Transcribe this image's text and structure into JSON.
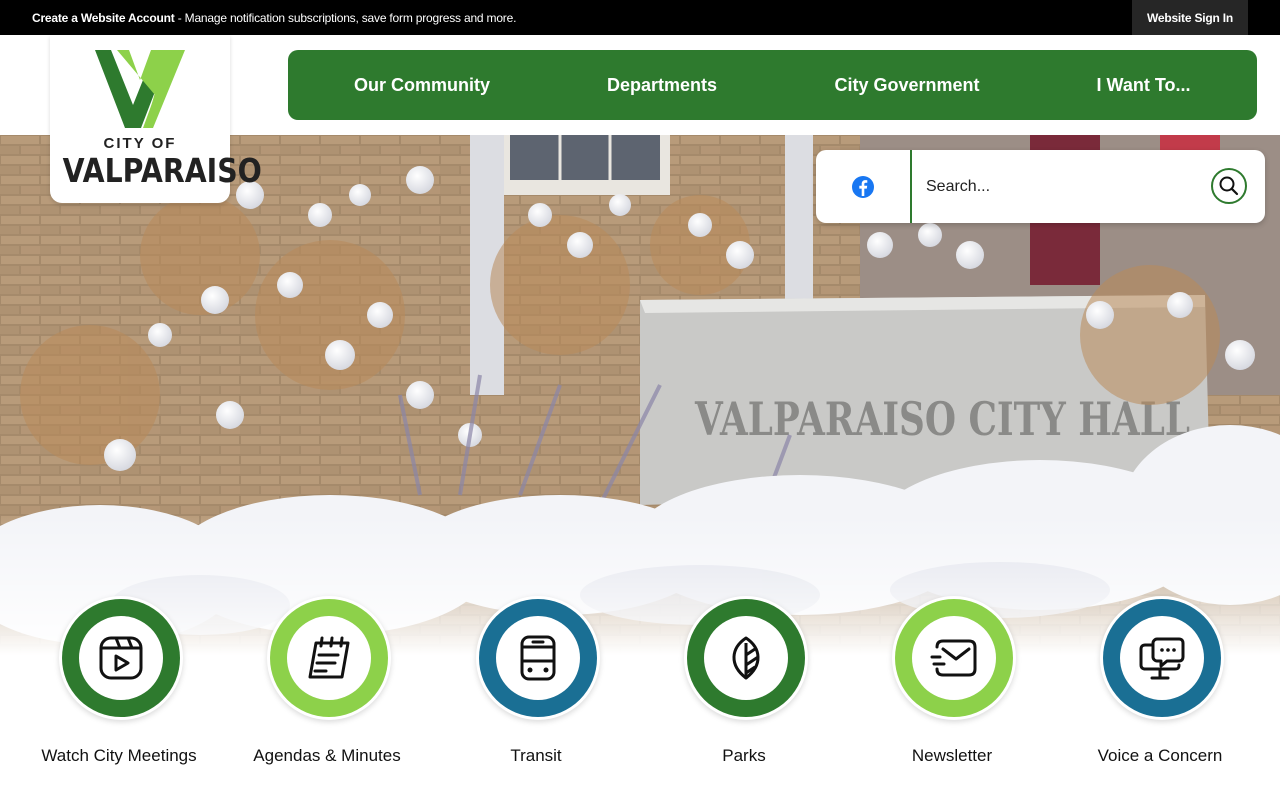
{
  "topbar": {
    "account_link": "Create a Website Account",
    "account_desc": " - Manage notification subscriptions, save form progress and more.",
    "signin_label": "Website Sign In"
  },
  "logo": {
    "city_of": "CITY OF",
    "name": "VALPARAISO"
  },
  "nav": {
    "items": [
      {
        "label": "Our Community"
      },
      {
        "label": "Departments"
      },
      {
        "label": "City Government"
      },
      {
        "label": "I Want To..."
      }
    ]
  },
  "search": {
    "placeholder": "Search...",
    "social_icon": "facebook-icon",
    "button_icon": "search-icon"
  },
  "hero": {
    "sign_text": "VALPARAISO CITY HALL"
  },
  "quick_links": [
    {
      "label": "Watch City Meetings",
      "icon": "video-play-icon",
      "color": "#2e7a2e"
    },
    {
      "label": "Agendas & Minutes",
      "icon": "notepad-icon",
      "color": "#8dd14a"
    },
    {
      "label": "Transit",
      "icon": "bus-icon",
      "color": "#1a6f94"
    },
    {
      "label": "Parks",
      "icon": "leaf-icon",
      "color": "#2e7a2e"
    },
    {
      "label": "Newsletter",
      "icon": "mail-icon",
      "color": "#8dd14a"
    },
    {
      "label": "Voice a Concern",
      "icon": "chat-monitor-icon",
      "color": "#1a6f94"
    }
  ],
  "colors": {
    "brand_green": "#2e7a2e",
    "light_green": "#8dd14a",
    "blue": "#1a6f94"
  }
}
